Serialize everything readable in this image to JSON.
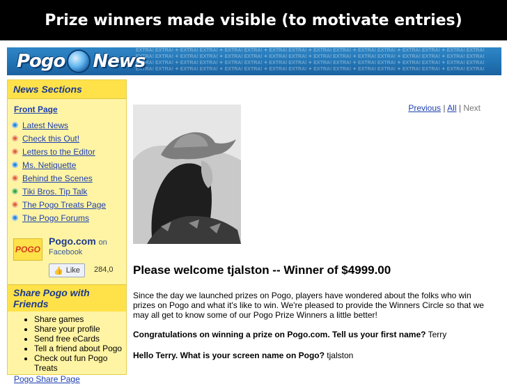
{
  "slide": {
    "title": "Prize winners made visible (to motivate entries)"
  },
  "banner": {
    "logo_left": "Pogo",
    "logo_right": "News",
    "pattern_text": "EXTRA! EXTRA! ✦ EXTRA! EXTRA! ✦ EXTRA! EXTRA! ✦ EXTRA! EXTRA! ✦ EXTRA! EXTRA! ✦ EXTRA! EXTRA! ✦ EXTRA! EXTRA! ✦ EXTRA! EXTRA!"
  },
  "sidebar": {
    "heading": "News Sections",
    "front_page": "Front Page",
    "items": [
      {
        "label": "Latest News",
        "color": "#2b88d8"
      },
      {
        "label": "Check this Out!",
        "color": "#e0662a"
      },
      {
        "label": "Letters to the Editor",
        "color": "#e0662a"
      },
      {
        "label": "Ms. Netiquette",
        "color": "#2b88d8"
      },
      {
        "label": "Behind the Scenes",
        "color": "#e0662a"
      },
      {
        "label": "Tiki Bros. Tip Talk",
        "color": "#3aa83a"
      },
      {
        "label": "The Pogo Treats Page",
        "color": "#e0662a"
      },
      {
        "label": "The Pogo Forums",
        "color": "#2b88d8"
      }
    ],
    "facebook": {
      "logo": "POGO",
      "name": "Pogo.com",
      "on": "on",
      "sub": "Facebook",
      "like": "Like",
      "count": "284,0"
    },
    "share": {
      "heading": "Share Pogo with Friends",
      "items": [
        "Share games",
        "Share your profile",
        "Send free eCards",
        "Tell a friend about Pogo",
        "Check out fun Pogo Treats"
      ],
      "page_link": "Pogo Share Page"
    }
  },
  "main": {
    "pager": {
      "previous": "Previous",
      "all": "All",
      "next": "Next",
      "sep": "|"
    },
    "headline": "Please welcome tjalston -- Winner of $4999.00",
    "intro": "Since the day we launched prizes on Pogo, players have wondered about the folks who win prizes on Pogo and what it's like to win. We're pleased to provide the Winners Circle so that we may all get to know some of our Pogo Prize Winners a little better!",
    "qa": [
      {
        "q": "Congratulations on winning a prize on Pogo.com. Tell us your first name?",
        "a": "Terry"
      },
      {
        "q": "Hello Terry. What is your screen name on Pogo?",
        "a": "tjalston"
      }
    ]
  }
}
